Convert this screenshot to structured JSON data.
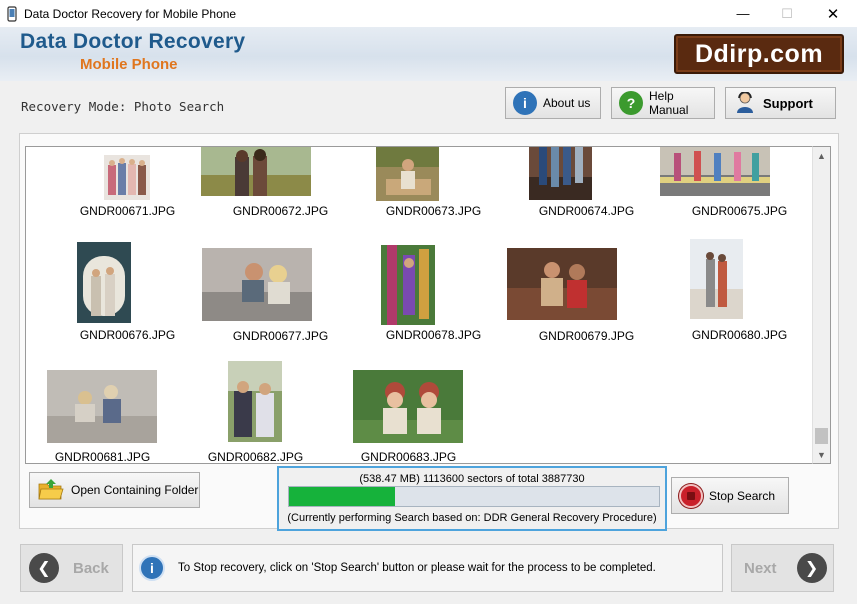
{
  "window": {
    "title": "Data Doctor Recovery for Mobile Phone",
    "minimize_glyph": "—",
    "maximize_glyph": "☐",
    "close_glyph": "✕"
  },
  "header": {
    "brand_main": "Data Doctor Recovery",
    "brand_sub": "Mobile Phone",
    "logo_text": "Ddirp.com"
  },
  "modebar": {
    "mode_text": "Recovery Mode: Photo Search",
    "about_label": "About us",
    "help_label": "Help Manual",
    "support_label": "Support"
  },
  "gallery": {
    "files": [
      "GNDR00671.JPG",
      "GNDR00672.JPG",
      "GNDR00673.JPG",
      "GNDR00674.JPG",
      "GNDR00675.JPG",
      "GNDR00676.JPG",
      "GNDR00677.JPG",
      "GNDR00678.JPG",
      "GNDR00679.JPG",
      "GNDR00680.JPG",
      "GNDR00681.JPG",
      "GNDR00682.JPG",
      "GNDR00683.JPG"
    ]
  },
  "actions": {
    "open_folder_label": "Open Containing Folder",
    "stop_search_label": "Stop Search"
  },
  "progress": {
    "line1": "(538.47 MB) 1113600  sectors  of  total 3887730",
    "line2": "(Currently performing Search based on:  DDR General Recovery Procedure)",
    "fraction": 0.2864
  },
  "footer": {
    "back_label": "Back",
    "next_label": "Next",
    "hint": "To Stop recovery, click on 'Stop Search' button or please wait for the process to be completed."
  },
  "colors": {
    "brand_blue": "#1f5a8c",
    "brand_orange": "#e0761e",
    "progress_green": "#16b23b",
    "focus_blue": "#4da3dc"
  },
  "icons": {
    "about": "info-icon",
    "help": "question-icon",
    "support": "support-person-icon",
    "folder": "folder-open-icon",
    "stop": "stop-icon",
    "back": "arrow-left-icon",
    "next": "arrow-right-icon",
    "hint": "info-icon"
  }
}
